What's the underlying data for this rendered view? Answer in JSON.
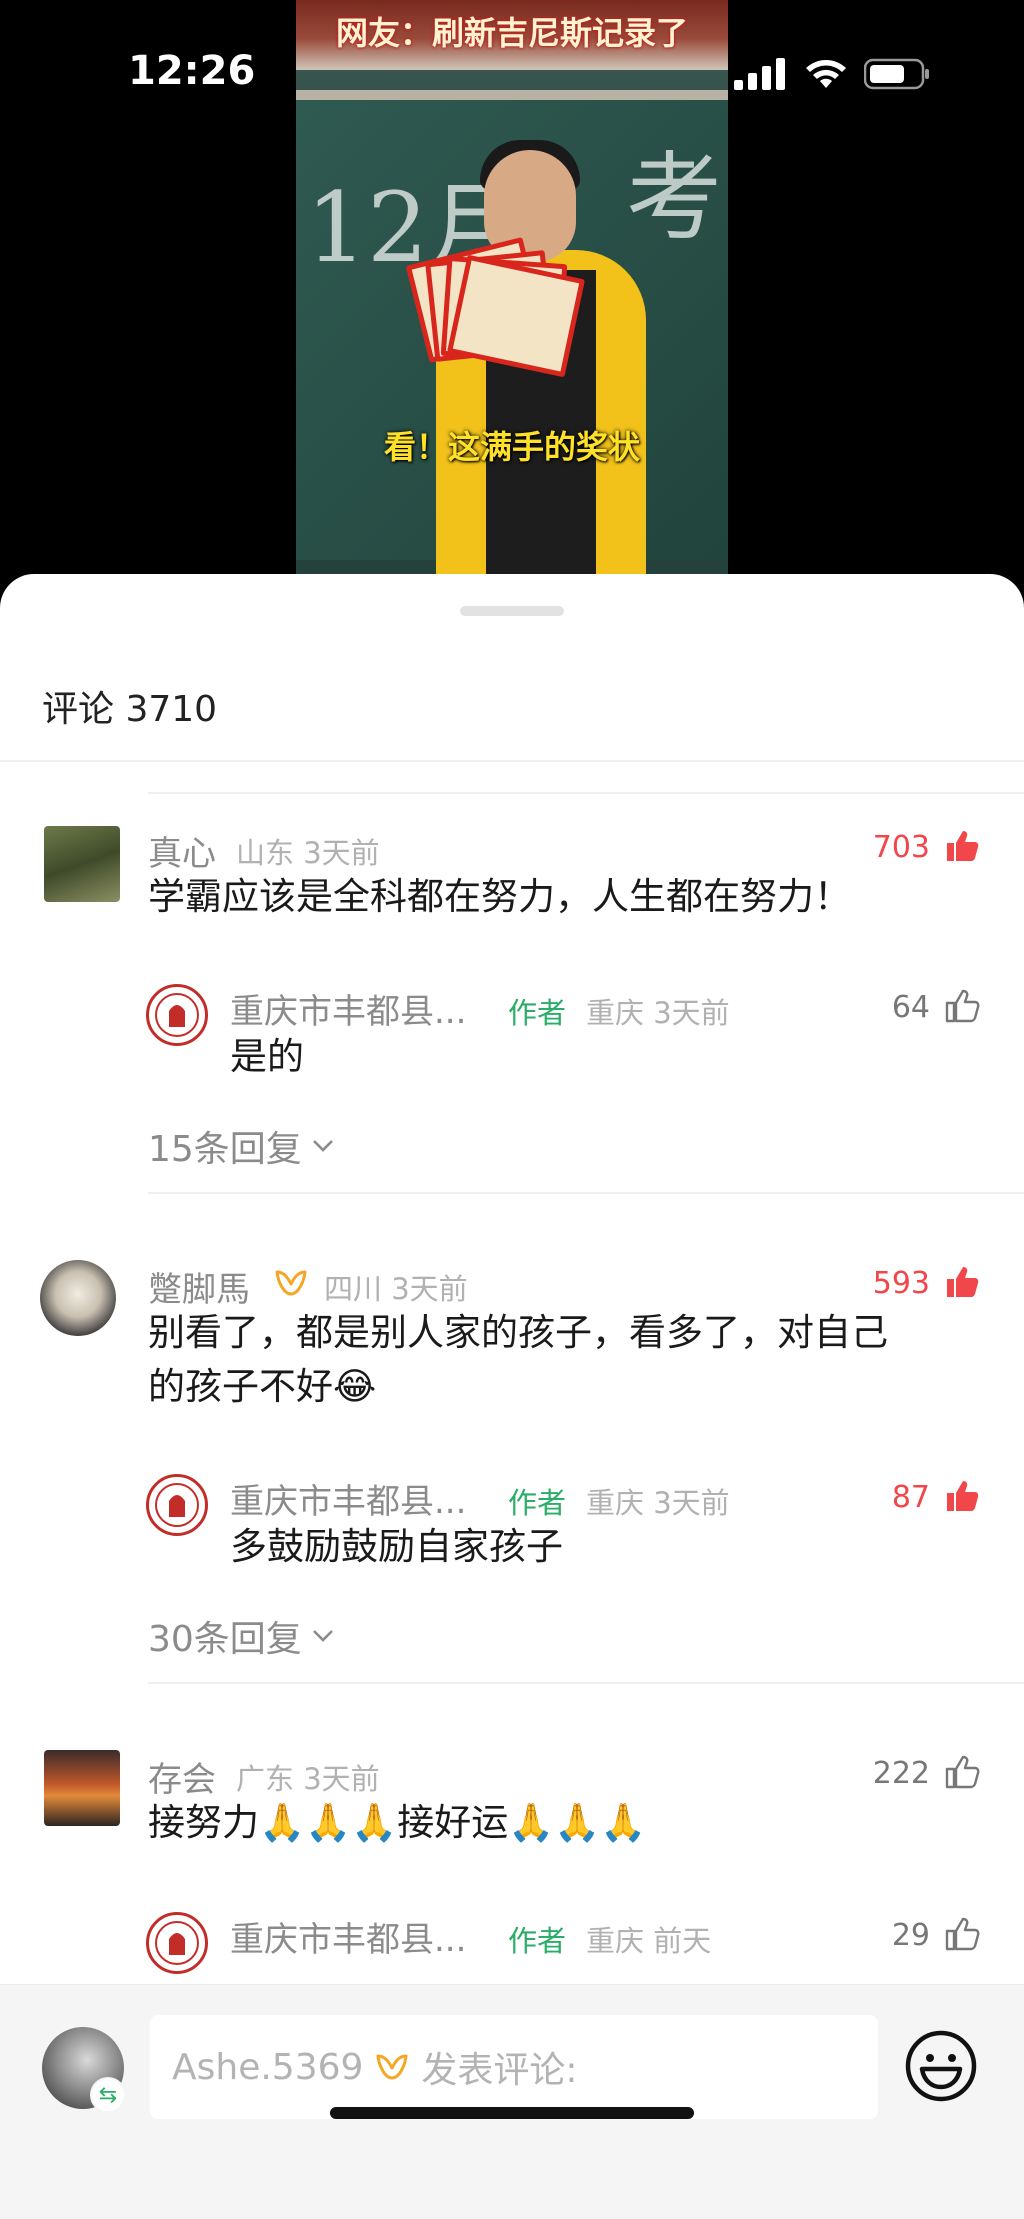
{
  "status_bar": {
    "time": "12:26"
  },
  "video": {
    "caption_top": "网友：刷新吉尼斯记录了",
    "caption_bottom": "看！这满手的奖状",
    "chalk_text": "12月",
    "chalk_text_2": "考"
  },
  "sheet": {
    "title": "评论 3710"
  },
  "comments": [
    {
      "username": "真心",
      "location": "山东",
      "time": "3天前",
      "likes": "703",
      "liked": true,
      "text": "学霸应该是全科都在努力，人生都在努力！",
      "reply": {
        "username": "重庆市丰都县...",
        "tag": "作者",
        "location": "重庆",
        "time": "3天前",
        "likes": "64",
        "liked": false,
        "text": "是的"
      },
      "more_replies": "15条回复"
    },
    {
      "username": "蹩脚馬",
      "location": "四川",
      "time": "3天前",
      "likes": "593",
      "liked": true,
      "text_line1": "别看了，都是别人家的孩子，看多了，对自己",
      "text_line2": "的孩子不好😂",
      "reply": {
        "username": "重庆市丰都县...",
        "tag": "作者",
        "location": "重庆",
        "time": "3天前",
        "likes": "87",
        "liked": true,
        "text": "多鼓励鼓励自家孩子"
      },
      "more_replies": "30条回复"
    },
    {
      "username": "存会",
      "location": "广东",
      "time": "3天前",
      "likes": "222",
      "liked": false,
      "text": "接努力🙏🙏🙏接好运🙏🙏🙏",
      "reply": {
        "username": "重庆市丰都县...",
        "tag": "作者",
        "location": "重庆",
        "time": "前天",
        "likes": "29",
        "liked": false
      }
    }
  ],
  "input_bar": {
    "my_name": "Ashe.5369",
    "placeholder": "发表评论:"
  },
  "colors": {
    "liked_red": "#f2474a",
    "author_green": "#2aae67",
    "vip_orange": "#f5a623"
  },
  "icons": [
    "signal-icon",
    "wifi-icon",
    "battery-icon",
    "thumb-up-icon",
    "chevron-down-icon",
    "vip-icon",
    "emoji-icon",
    "switch-account-icon"
  ]
}
